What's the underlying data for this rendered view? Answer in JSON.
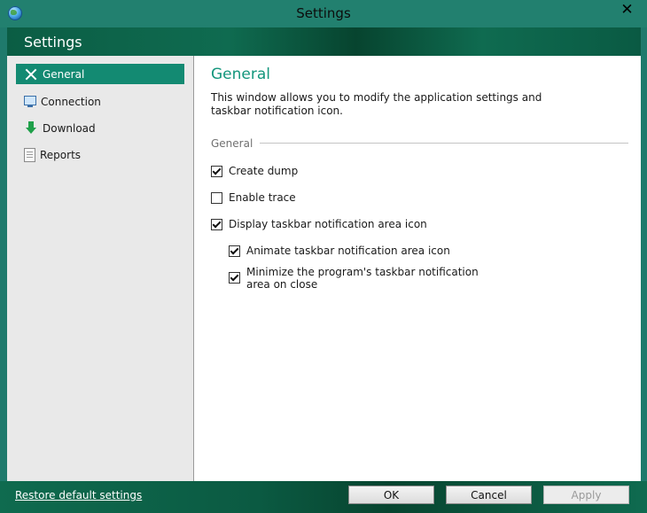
{
  "window": {
    "title": "Settings",
    "close_glyph": "✕"
  },
  "header": {
    "title": "Settings"
  },
  "sidebar": {
    "items": [
      {
        "label": "General",
        "icon": "tools-icon",
        "active": true
      },
      {
        "label": "Connection",
        "icon": "monitor-icon",
        "active": false
      },
      {
        "label": "Download",
        "icon": "download-arrow-icon",
        "active": false
      },
      {
        "label": "Reports",
        "icon": "report-icon",
        "active": false
      }
    ]
  },
  "content": {
    "title": "General",
    "description": "This window allows you to modify the application settings and taskbar notification icon.",
    "group_label": "General",
    "options": [
      {
        "label": "Create dump",
        "checked": true
      },
      {
        "label": "Enable trace",
        "checked": false
      },
      {
        "label": "Display taskbar notification area icon",
        "checked": true
      },
      {
        "label": "Animate taskbar notification area icon",
        "checked": true
      },
      {
        "label": "Minimize the program's taskbar notification area on close",
        "checked": true
      }
    ]
  },
  "footer": {
    "restore_label": "Restore default settings",
    "ok_label": "OK",
    "cancel_label": "Cancel",
    "apply_label": "Apply"
  },
  "colors": {
    "accent": "#13967c",
    "active_item": "#138a72",
    "header_band": "#0b5d44"
  }
}
